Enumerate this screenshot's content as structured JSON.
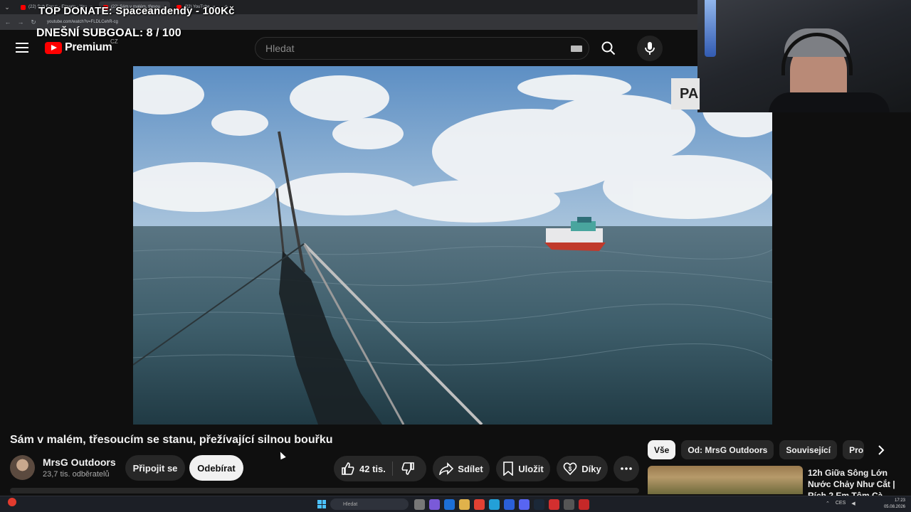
{
  "browser": {
    "tabs": [
      {
        "label": "(22) Sub Focus - Elevate - You",
        "active": false
      },
      {
        "label": "(22) Sám v malém, třesou",
        "active": true
      },
      {
        "label": "(22) YouTube",
        "active": false
      }
    ],
    "new_tab": "+",
    "url": "youtube.com/watch?v=FLDLCehR-cg"
  },
  "stream_overlay": {
    "top_donate": "TOP DONATE: Spaceandendy - 100Kč",
    "subgoal": "DNEŠNÍ SUBGOAL:  8 / 100",
    "badge": "PA"
  },
  "header": {
    "logo_text": "Premium",
    "country": "CZ",
    "search_placeholder": "Hledat"
  },
  "video": {
    "title": "Sám v malém, třesoucím se stanu, přežívající silnou bouřku"
  },
  "channel": {
    "name": "MrsG Outdoors",
    "subscribers": "23,7 tis. odběratelů",
    "join_label": "Připojit se",
    "subscribe_label": "Odebírat"
  },
  "actions": {
    "likes": "42 tis.",
    "share": "Sdílet",
    "save": "Uložit",
    "thanks": "Díky"
  },
  "chips": [
    {
      "label": "Vše",
      "active": true
    },
    {
      "label": "Od: MrsG Outdoors",
      "active": false
    },
    {
      "label": "Související",
      "active": false
    },
    {
      "label": "Pro",
      "active": false
    }
  ],
  "recommendation": {
    "title": "12h Giữa Sông Lớn Nước Chảy Như Cắt | Rích 2 Em Tôm Cà..."
  },
  "taskbar": {
    "search_placeholder": "Hledat",
    "language": "CES",
    "time": "17:23",
    "date": "05.08.2026"
  },
  "colors": {
    "youtube_red": "#ff0000",
    "background": "#0f0f0f",
    "button_bg": "#272727"
  }
}
